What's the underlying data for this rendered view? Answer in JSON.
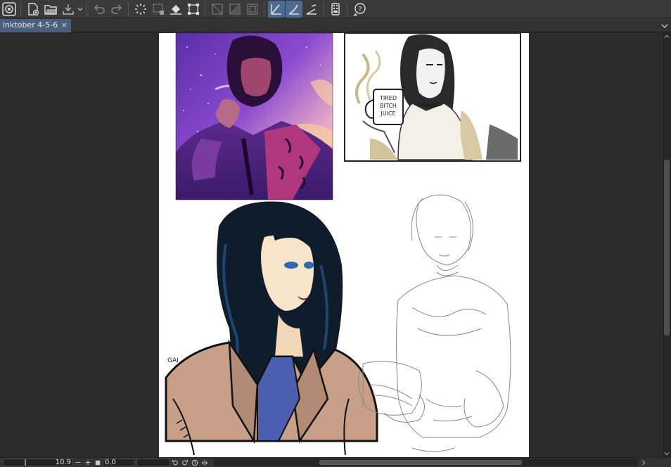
{
  "toolbar": {
    "buttons": [
      "logo-icon",
      "new-canvas-icon",
      "open-folder-icon",
      "save-icon",
      "undo-icon",
      "redo-icon",
      "loading-spinner-icon",
      "selection-icon",
      "fill-icon",
      "transform-icon",
      "snap-grid-icon",
      "snap-ruler-icon",
      "border-icon",
      "ruler-snap-icon",
      "brush-snap-icon",
      "perspective-snap-icon",
      "device-icon",
      "help-icon"
    ]
  },
  "tab": {
    "title": "inktober 4-5-6",
    "close": "×"
  },
  "status": {
    "zoom": "10.9",
    "zoom_minus": "−",
    "zoom_plus": "+",
    "angle": "0.0"
  },
  "colors": {
    "toolbar_bg": "#3a3a3a",
    "tab_active": "#4a5f7d",
    "canvas_bg": "#2c2c2c",
    "paper": "#ffffff",
    "accent_red": "#c11a1a",
    "hair_blue": "#1a3550"
  }
}
